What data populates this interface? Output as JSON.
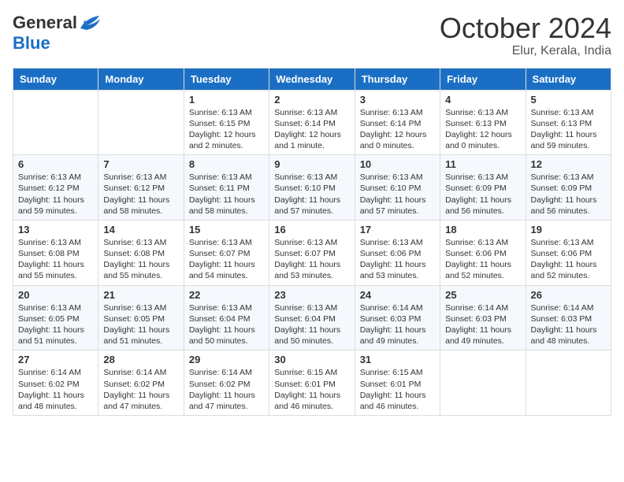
{
  "header": {
    "logo": {
      "general": "General",
      "blue": "Blue"
    },
    "title": "October 2024",
    "location": "Elur, Kerala, India"
  },
  "weekdays": [
    "Sunday",
    "Monday",
    "Tuesday",
    "Wednesday",
    "Thursday",
    "Friday",
    "Saturday"
  ],
  "weeks": [
    [
      null,
      null,
      {
        "day": 1,
        "sunrise": "Sunrise: 6:13 AM",
        "sunset": "Sunset: 6:15 PM",
        "daylight": "Daylight: 12 hours and 2 minutes."
      },
      {
        "day": 2,
        "sunrise": "Sunrise: 6:13 AM",
        "sunset": "Sunset: 6:14 PM",
        "daylight": "Daylight: 12 hours and 1 minute."
      },
      {
        "day": 3,
        "sunrise": "Sunrise: 6:13 AM",
        "sunset": "Sunset: 6:14 PM",
        "daylight": "Daylight: 12 hours and 0 minutes."
      },
      {
        "day": 4,
        "sunrise": "Sunrise: 6:13 AM",
        "sunset": "Sunset: 6:13 PM",
        "daylight": "Daylight: 12 hours and 0 minutes."
      },
      {
        "day": 5,
        "sunrise": "Sunrise: 6:13 AM",
        "sunset": "Sunset: 6:13 PM",
        "daylight": "Daylight: 11 hours and 59 minutes."
      }
    ],
    [
      {
        "day": 6,
        "sunrise": "Sunrise: 6:13 AM",
        "sunset": "Sunset: 6:12 PM",
        "daylight": "Daylight: 11 hours and 59 minutes."
      },
      {
        "day": 7,
        "sunrise": "Sunrise: 6:13 AM",
        "sunset": "Sunset: 6:12 PM",
        "daylight": "Daylight: 11 hours and 58 minutes."
      },
      {
        "day": 8,
        "sunrise": "Sunrise: 6:13 AM",
        "sunset": "Sunset: 6:11 PM",
        "daylight": "Daylight: 11 hours and 58 minutes."
      },
      {
        "day": 9,
        "sunrise": "Sunrise: 6:13 AM",
        "sunset": "Sunset: 6:10 PM",
        "daylight": "Daylight: 11 hours and 57 minutes."
      },
      {
        "day": 10,
        "sunrise": "Sunrise: 6:13 AM",
        "sunset": "Sunset: 6:10 PM",
        "daylight": "Daylight: 11 hours and 57 minutes."
      },
      {
        "day": 11,
        "sunrise": "Sunrise: 6:13 AM",
        "sunset": "Sunset: 6:09 PM",
        "daylight": "Daylight: 11 hours and 56 minutes."
      },
      {
        "day": 12,
        "sunrise": "Sunrise: 6:13 AM",
        "sunset": "Sunset: 6:09 PM",
        "daylight": "Daylight: 11 hours and 56 minutes."
      }
    ],
    [
      {
        "day": 13,
        "sunrise": "Sunrise: 6:13 AM",
        "sunset": "Sunset: 6:08 PM",
        "daylight": "Daylight: 11 hours and 55 minutes."
      },
      {
        "day": 14,
        "sunrise": "Sunrise: 6:13 AM",
        "sunset": "Sunset: 6:08 PM",
        "daylight": "Daylight: 11 hours and 55 minutes."
      },
      {
        "day": 15,
        "sunrise": "Sunrise: 6:13 AM",
        "sunset": "Sunset: 6:07 PM",
        "daylight": "Daylight: 11 hours and 54 minutes."
      },
      {
        "day": 16,
        "sunrise": "Sunrise: 6:13 AM",
        "sunset": "Sunset: 6:07 PM",
        "daylight": "Daylight: 11 hours and 53 minutes."
      },
      {
        "day": 17,
        "sunrise": "Sunrise: 6:13 AM",
        "sunset": "Sunset: 6:06 PM",
        "daylight": "Daylight: 11 hours and 53 minutes."
      },
      {
        "day": 18,
        "sunrise": "Sunrise: 6:13 AM",
        "sunset": "Sunset: 6:06 PM",
        "daylight": "Daylight: 11 hours and 52 minutes."
      },
      {
        "day": 19,
        "sunrise": "Sunrise: 6:13 AM",
        "sunset": "Sunset: 6:06 PM",
        "daylight": "Daylight: 11 hours and 52 minutes."
      }
    ],
    [
      {
        "day": 20,
        "sunrise": "Sunrise: 6:13 AM",
        "sunset": "Sunset: 6:05 PM",
        "daylight": "Daylight: 11 hours and 51 minutes."
      },
      {
        "day": 21,
        "sunrise": "Sunrise: 6:13 AM",
        "sunset": "Sunset: 6:05 PM",
        "daylight": "Daylight: 11 hours and 51 minutes."
      },
      {
        "day": 22,
        "sunrise": "Sunrise: 6:13 AM",
        "sunset": "Sunset: 6:04 PM",
        "daylight": "Daylight: 11 hours and 50 minutes."
      },
      {
        "day": 23,
        "sunrise": "Sunrise: 6:13 AM",
        "sunset": "Sunset: 6:04 PM",
        "daylight": "Daylight: 11 hours and 50 minutes."
      },
      {
        "day": 24,
        "sunrise": "Sunrise: 6:14 AM",
        "sunset": "Sunset: 6:03 PM",
        "daylight": "Daylight: 11 hours and 49 minutes."
      },
      {
        "day": 25,
        "sunrise": "Sunrise: 6:14 AM",
        "sunset": "Sunset: 6:03 PM",
        "daylight": "Daylight: 11 hours and 49 minutes."
      },
      {
        "day": 26,
        "sunrise": "Sunrise: 6:14 AM",
        "sunset": "Sunset: 6:03 PM",
        "daylight": "Daylight: 11 hours and 48 minutes."
      }
    ],
    [
      {
        "day": 27,
        "sunrise": "Sunrise: 6:14 AM",
        "sunset": "Sunset: 6:02 PM",
        "daylight": "Daylight: 11 hours and 48 minutes."
      },
      {
        "day": 28,
        "sunrise": "Sunrise: 6:14 AM",
        "sunset": "Sunset: 6:02 PM",
        "daylight": "Daylight: 11 hours and 47 minutes."
      },
      {
        "day": 29,
        "sunrise": "Sunrise: 6:14 AM",
        "sunset": "Sunset: 6:02 PM",
        "daylight": "Daylight: 11 hours and 47 minutes."
      },
      {
        "day": 30,
        "sunrise": "Sunrise: 6:15 AM",
        "sunset": "Sunset: 6:01 PM",
        "daylight": "Daylight: 11 hours and 46 minutes."
      },
      {
        "day": 31,
        "sunrise": "Sunrise: 6:15 AM",
        "sunset": "Sunset: 6:01 PM",
        "daylight": "Daylight: 11 hours and 46 minutes."
      },
      null,
      null
    ]
  ]
}
